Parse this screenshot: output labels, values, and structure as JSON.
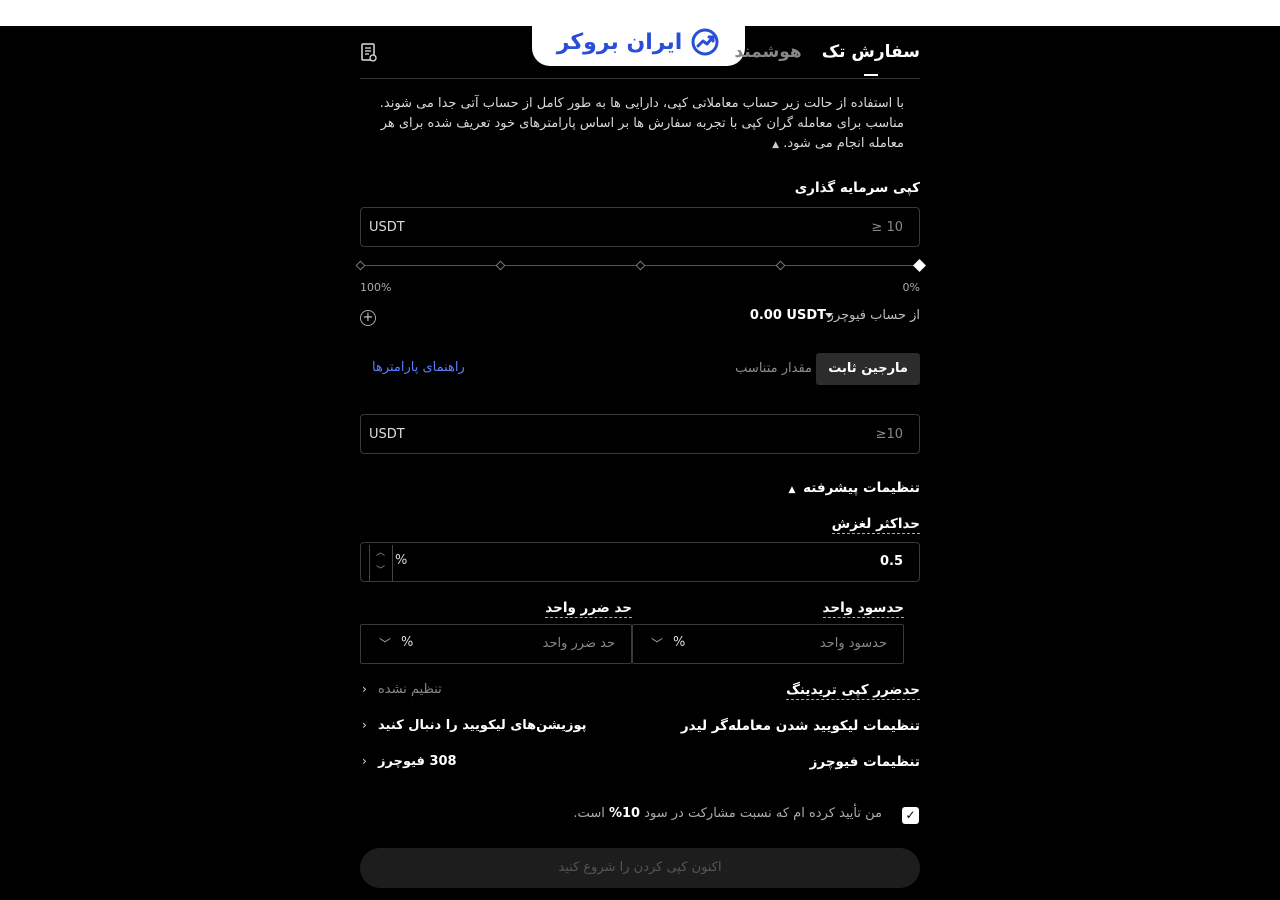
{
  "logo": {
    "text": "ایران بروکر"
  },
  "tabs": [
    {
      "label": "هوشمند",
      "active": false
    },
    {
      "label": "سفارش تک",
      "active": true
    }
  ],
  "description": "با استفاده از حالت زیر حساب معاملاتی کپی، دارایی ها به طور کامل از حساب آتی جدا می شوند. مناسب برای معامله گران کپی با تجربه سفارش ها بر اساس پارامترهای خود تعریف شده برای هر معامله انجام می شود.",
  "investment": {
    "label": "کپی سرمایه گذاری",
    "placeholder": "≥ 10",
    "unit": "USDT",
    "slider_min_label": "0%",
    "slider_max_label": "100%",
    "slider_value": 0
  },
  "balance": {
    "label": "از حساب فیوچرز",
    "value": "0.00 USDT"
  },
  "mode": {
    "fixed_margin": "مارجین ثابت",
    "proportional": "مقدار متناسب",
    "guide": "راهنمای پارامترها",
    "placeholder": "≥10",
    "unit": "USDT"
  },
  "advanced": {
    "title": "تنظیمات پیشرفته",
    "slippage_label": "حداکثر لغزش",
    "slippage_value": "0.5",
    "slippage_unit": "%",
    "take_profit_label": "حدسود واحد",
    "take_profit_placeholder": "حدسود واحد",
    "stop_loss_label": "حد ضرر واحد",
    "stop_loss_placeholder": "حد ضرر واحد",
    "percent_unit": "%"
  },
  "settings": [
    {
      "key": "حدضرر کپی تریدینگ",
      "value": "تنظیم نشده"
    },
    {
      "key": "تنظیمات لیکویید شدن معامله‌گر لیدر",
      "value": "پوزیشن‌های لیکویید را دنبال کنید"
    },
    {
      "key": "تنظیمات فیوچرز",
      "value": "308 فیوچرز"
    }
  ],
  "agreement": {
    "prefix": "من تأیید کرده ام که نسبت مشارکت در سود",
    "percent": "10%",
    "suffix": "است.",
    "checked": true
  },
  "start_button": "اکنون کپی کردن را شروع کنید"
}
